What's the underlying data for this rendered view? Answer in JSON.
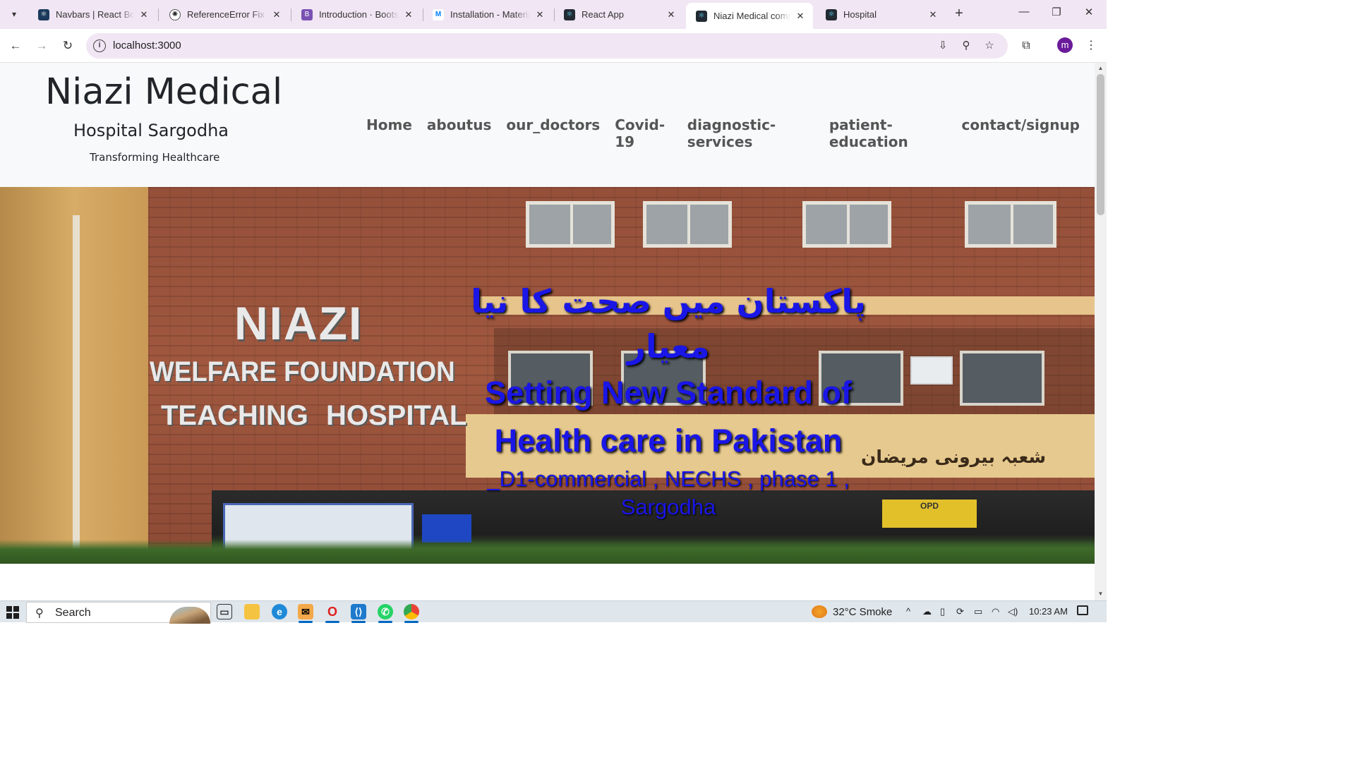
{
  "browser": {
    "tabs": [
      {
        "title": "Navbars | React Bootstrap",
        "favicon": "react-bootstrap-icon",
        "active": false
      },
      {
        "title": "ReferenceError Fix Guide",
        "favicon": "chatgpt-icon",
        "active": false
      },
      {
        "title": "Introduction · Bootstrap",
        "favicon": "bootstrap-icon",
        "active": false
      },
      {
        "title": "Installation - Material UI",
        "favicon": "mui-icon",
        "active": false
      },
      {
        "title": "React App",
        "favicon": "react-icon",
        "active": false
      },
      {
        "title": "Niazi Medical complex",
        "favicon": "react-icon",
        "active": true
      },
      {
        "title": "Hospital",
        "favicon": "react-icon",
        "active": false
      }
    ],
    "url": "localhost:3000",
    "profile_initial": "m"
  },
  "page": {
    "brand": {
      "title": "Niazi Medical",
      "subtitle": "Hospital Sargodha",
      "tagline": "Transforming Healthcare"
    },
    "nav": [
      "Home",
      "aboutus",
      "our_doctors",
      "Covid-19",
      "diagnostic-services",
      "patient-education",
      "contact/signup"
    ],
    "hero": {
      "urdu_title": "پاکستان میں صحت کا نیا معیار",
      "title_line1": "Setting New Standard of",
      "title_line2": "Health care in Pakistan",
      "address_line1": "_D1-commercial , NECHS , phase 1 ,",
      "address_line2": "Sargodha",
      "photo_sign": {
        "line1": "NIAZI",
        "line2": "WELFARE FOUNDATION",
        "line3": "TEACHING  HOSPITAL",
        "urdu": "شعبہ بیرونی مریضان",
        "opd": "OPD"
      }
    }
  },
  "taskbar": {
    "search_label": "Search",
    "weather": "32°C  Smoke",
    "time": "10:23 AM"
  }
}
